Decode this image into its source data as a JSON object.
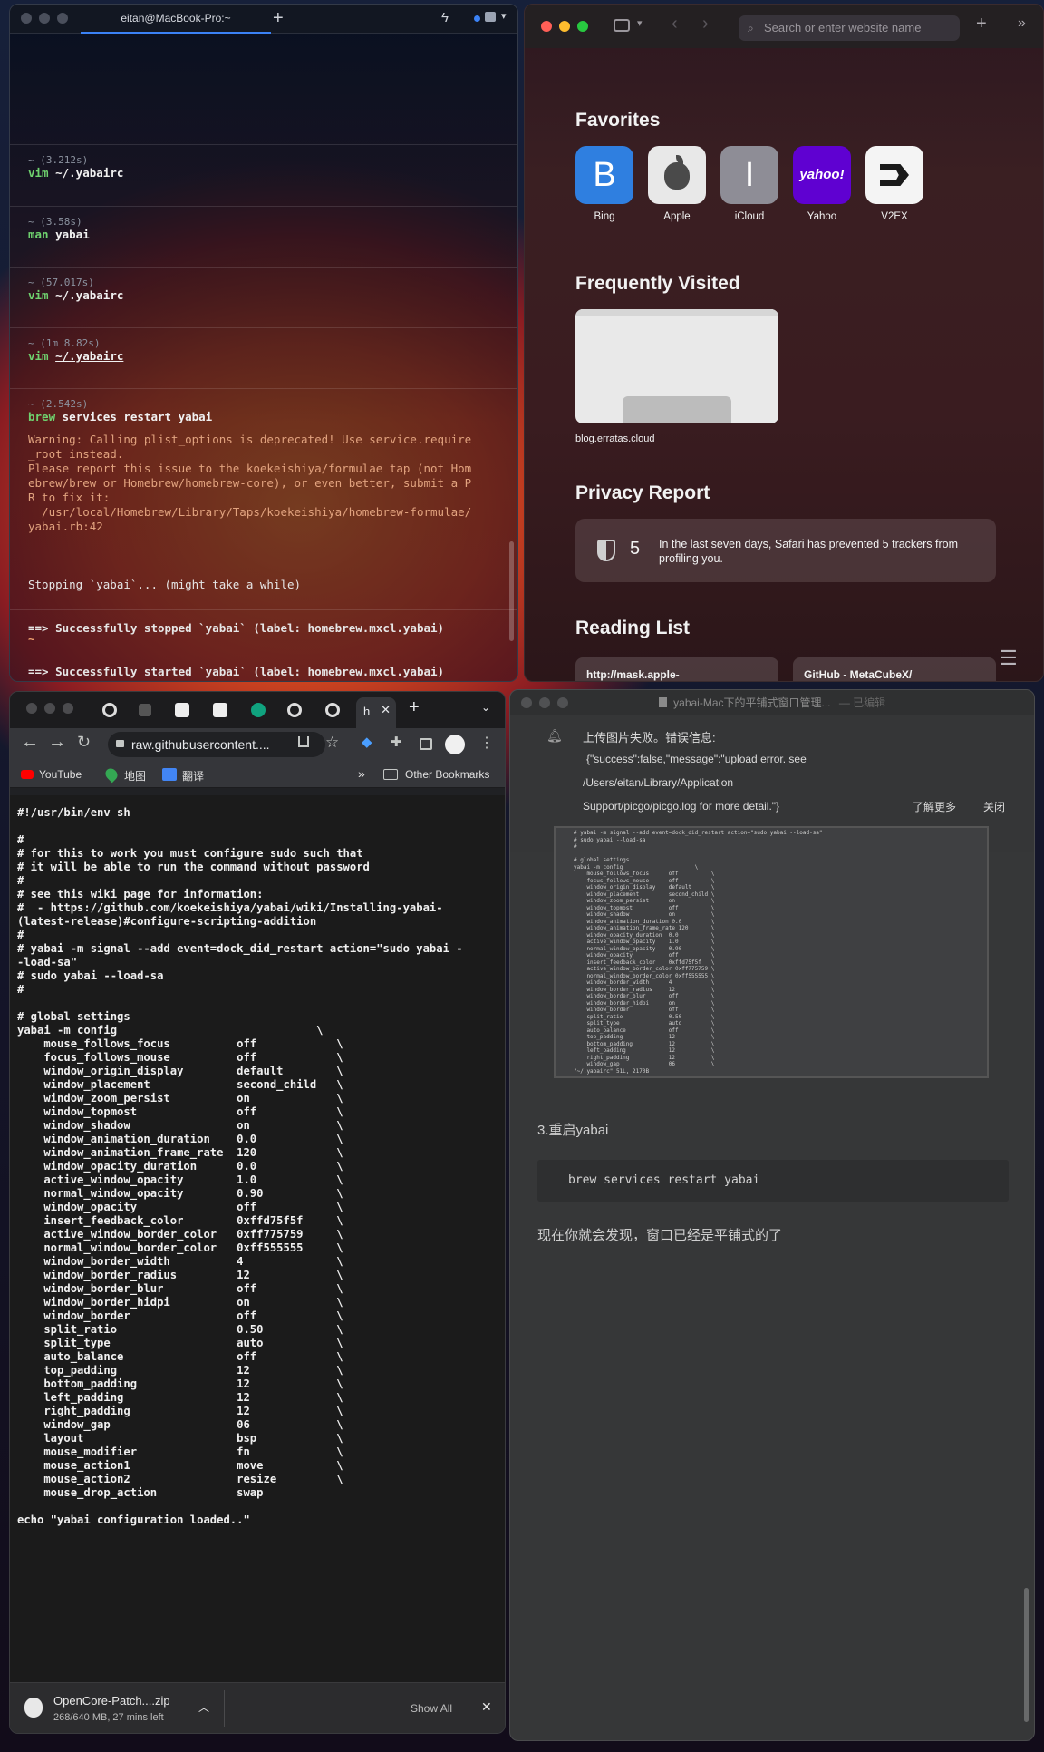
{
  "terminal": {
    "title": "eitan@MacBook-Pro:~",
    "blocks": [
      {
        "time": "~ (3.212s)",
        "cmd": "vim",
        "arg": "~/.yabairc"
      },
      {
        "time": "~ (3.58s)",
        "cmd": "man",
        "arg": "yabai"
      },
      {
        "time": "~ (57.017s)",
        "cmd": "vim",
        "arg": "~/.yabairc"
      },
      {
        "time": "~ (1m 8.82s)",
        "cmd": "vim",
        "arg": "~/.yabairc"
      },
      {
        "time": "~ (2.542s)",
        "cmd": "brew",
        "arg": "services restart yabai"
      }
    ],
    "warning": "Warning: Calling plist_options is deprecated! Use service.require\n_root instead.\nPlease report this issue to the koekeishiya/formulae tap (not Hom\nebrew/brew or Homebrew/homebrew-core), or even better, submit a P\nR to fix it:\n  /usr/local/Homebrew/Library/Taps/koekeishiya/homebrew-formulae/\nyabai.rb:42",
    "stopping": "Stopping `yabai`... (might take a while)",
    "success1": "==> Successfully stopped `yabai` (label: homebrew.mxcl.yabai)",
    "success2": "==> Successfully started `yabai` (label: homebrew.mxcl.yabai)",
    "prompt": "~"
  },
  "safari": {
    "search_placeholder": "Search or enter website name",
    "favorites_title": "Favorites",
    "favorites": [
      {
        "label": "Bing",
        "glyph": "B",
        "color": "#2f7fe0"
      },
      {
        "label": "Apple",
        "glyph": "",
        "color": "#e8e8e8"
      },
      {
        "label": "iCloud",
        "glyph": "I",
        "color": "#8e8d96"
      },
      {
        "label": "Yahoo",
        "glyph": "yahoo!",
        "color": "#5f01d1"
      },
      {
        "label": "V2EX",
        "glyph": "",
        "color": "#f4f4f4"
      }
    ],
    "frequent_title": "Frequently Visited",
    "frequent_label": "blog.erratas.cloud",
    "privacy_title": "Privacy Report",
    "privacy_count": "5",
    "privacy_text": "In the last seven days, Safari has prevented 5 trackers from profiling you.",
    "reading_title": "Reading List",
    "reading": [
      "http://mask.apple-",
      "GitHub - MetaCubeX/"
    ]
  },
  "chrome": {
    "address": "raw.githubusercontent....",
    "tab_active_label": "h",
    "bookmarks": [
      "YouTube",
      "地图",
      "翻译"
    ],
    "other_bookmarks": "Other Bookmarks",
    "code": "#!/usr/bin/env sh\n\n#\n# for this to work you must configure sudo such that\n# it will be able to run the command without password\n#\n# see this wiki page for information:\n#  - https://github.com/koekeishiya/yabai/wiki/Installing-yabai-\n(latest-release)#configure-scripting-addition\n#\n# yabai -m signal --add event=dock_did_restart action=\"sudo yabai -\n-load-sa\"\n# sudo yabai --load-sa\n#\n\n# global settings\nyabai -m config                              \\\n    mouse_follows_focus          off            \\\n    focus_follows_mouse          off            \\\n    window_origin_display        default        \\\n    window_placement             second_child   \\\n    window_zoom_persist          on             \\\n    window_topmost               off            \\\n    window_shadow                on             \\\n    window_animation_duration    0.0            \\\n    window_animation_frame_rate  120            \\\n    window_opacity_duration      0.0            \\\n    active_window_opacity        1.0            \\\n    normal_window_opacity        0.90           \\\n    window_opacity               off            \\\n    insert_feedback_color        0xffd75f5f     \\\n    active_window_border_color   0xff775759     \\\n    normal_window_border_color   0xff555555     \\\n    window_border_width          4              \\\n    window_border_radius         12             \\\n    window_border_blur           off            \\\n    window_border_hidpi          on             \\\n    window_border                off            \\\n    split_ratio                  0.50           \\\n    split_type                   auto           \\\n    auto_balance                 off            \\\n    top_padding                  12             \\\n    bottom_padding               12             \\\n    left_padding                 12             \\\n    right_padding                12             \\\n    window_gap                   06             \\\n    layout                       bsp            \\\n    mouse_modifier               fn             \\\n    mouse_action1                move           \\\n    mouse_action2                resize         \\\n    mouse_drop_action            swap\n\necho \"yabai configuration loaded..\"",
    "download_name": "OpenCore-Patch....zip",
    "download_status": "268/640 MB, 27 mins left",
    "show_all": "Show All"
  },
  "typora": {
    "title": "yabai-Mac下的平铺式窗口管理...",
    "title_suffix": "— 已编辑",
    "notif_line1": "上传图片失败。错误信息:",
    "notif_line2": "{\"success\":false,\"message\":\"upload error. see",
    "notif_line3": "/Users/eitan/Library/Application",
    "notif_line4": "Support/picgo/picgo.log for more detail.\"}",
    "learn_more": "了解更多",
    "close": "关闭",
    "heading3": "3.重启yabai",
    "code": "brew services restart yabai",
    "conclusion": "现在你就会发现，窗口已经是平铺式的了",
    "shot_text": "# yabai -m signal --add event=dock_did_restart action=\"sudo yabai --load-sa\"\n# sudo yabai --load-sa\n#\n\n# global settings\nyabai -m config                      \\\n    mouse_follows_focus      off          \\\n    focus_follows_mouse      off          \\\n    window_origin_display    default      \\\n    window_placement         second_child \\\n    window_zoom_persist      on           \\\n    window_topmost           off          \\\n    window_shadow            on           \\\n    window_animation_duration 0.0         \\\n    window_animation_frame_rate 120       \\\n    window_opacity_duration  0.0          \\\n    active_window_opacity    1.0          \\\n    normal_window_opacity    0.90         \\\n    window_opacity           off          \\\n    insert_feedback_color    0xffd75f5f   \\\n    active_window_border_color 0xff775759 \\\n    normal_window_border_color 0xff555555 \\\n    window_border_width      4            \\\n    window_border_radius     12           \\\n    window_border_blur       off          \\\n    window_border_hidpi      on           \\\n    window_border            off          \\\n    split_ratio              0.50         \\\n    split_type               auto         \\\n    auto_balance             off          \\\n    top_padding              12           \\\n    bottom_padding           12           \\\n    left_padding             12           \\\n    right_padding            12           \\\n    window_gap               06           \\\n\"~/.yabairc\" 51L, 2170B"
  }
}
